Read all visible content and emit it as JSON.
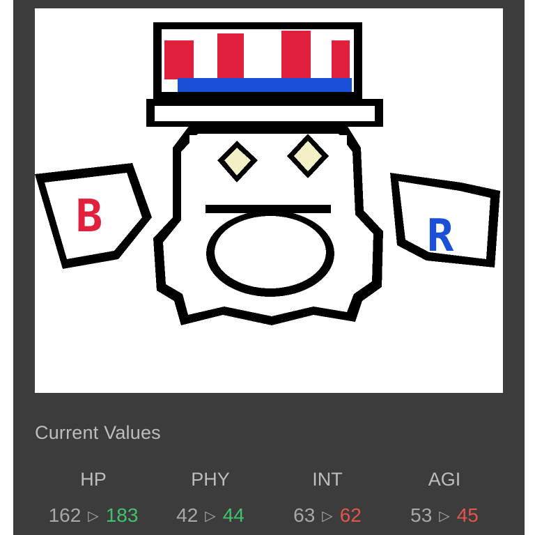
{
  "section_title": "Current Values",
  "stats": [
    {
      "label": "HP",
      "current": "162",
      "next": "183",
      "trend": "up"
    },
    {
      "label": "PHY",
      "current": "42",
      "next": "44",
      "trend": "up"
    },
    {
      "label": "INT",
      "current": "63",
      "next": "62",
      "trend": "down"
    },
    {
      "label": "AGI",
      "current": "53",
      "next": "45",
      "trend": "down"
    }
  ],
  "arrow_glyph": "▷",
  "colors": {
    "panel": "#3c3c3c",
    "increase": "#3fc46e",
    "decrease": "#e2554b",
    "hat_red": "#e0203c",
    "hat_blue": "#1a4fd8"
  }
}
